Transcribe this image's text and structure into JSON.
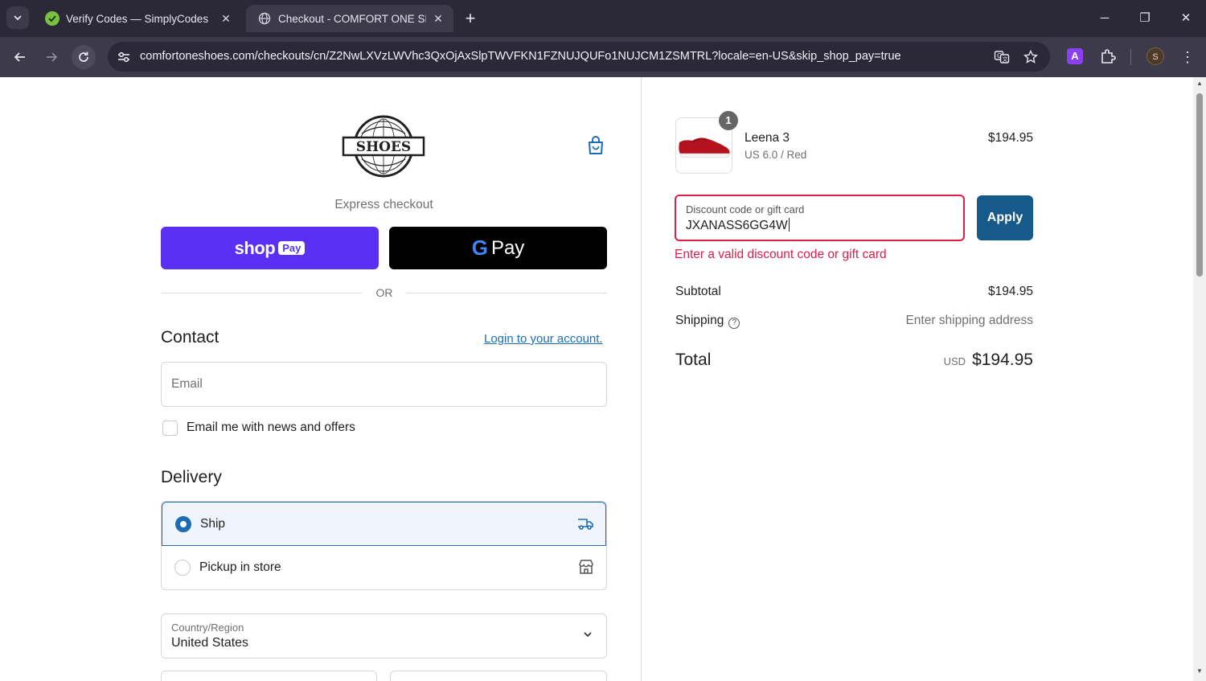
{
  "browser": {
    "tabs": [
      {
        "title": "Verify Codes — SimplyCodes",
        "icon": "simplycodes-check-icon",
        "active": false
      },
      {
        "title": "Checkout - COMFORT ONE SHOES",
        "icon": "globe-icon",
        "active": true
      }
    ],
    "url": "comfortoneshoes.com/checkouts/cn/Z2NwLXVzLWVhc3QxOjAxSlpTWVFKN1FZNUJQUFo1NUJCM1ZSMTRL?locale=en-US&skip_shop_pay=true",
    "profile_initial": "S",
    "extension_label": "A",
    "accent_color": "#8a3ff0"
  },
  "checkout": {
    "brand_logo_text": "SHOES",
    "express_checkout_label": "Express checkout",
    "shop_pay": {
      "shop": "shop",
      "pay": "Pay"
    },
    "gpay": {
      "g": "G",
      "pay": "Pay"
    },
    "or_label": "OR",
    "contact": {
      "heading": "Contact",
      "login_link": "Login to your account.",
      "email_placeholder": "Email",
      "newsletter_label": "Email me with news and offers"
    },
    "delivery": {
      "heading": "Delivery",
      "options": [
        {
          "label": "Ship",
          "selected": true,
          "icon": "truck-icon"
        },
        {
          "label": "Pickup in store",
          "selected": false,
          "icon": "store-icon"
        }
      ],
      "country_label": "Country/Region",
      "country_value": "United States"
    }
  },
  "summary": {
    "product": {
      "name": "Leena 3",
      "variant": "US 6.0 / Red",
      "price": "$194.95",
      "quantity": "1"
    },
    "discount": {
      "label": "Discount code or gift card",
      "value": "JXANASS6GG4W",
      "apply_label": "Apply",
      "error": "Enter a valid discount code or gift card",
      "error_color": "#dd1d4a"
    },
    "subtotal_label": "Subtotal",
    "subtotal_value": "$194.95",
    "shipping_label": "Shipping",
    "shipping_value": "Enter shipping address",
    "total_label": "Total",
    "total_currency": "USD",
    "total_value": "$194.95"
  },
  "colors": {
    "primary": "#1d6db5",
    "apply_button": "#155a8a",
    "shop_pay": "#5a31f4"
  }
}
